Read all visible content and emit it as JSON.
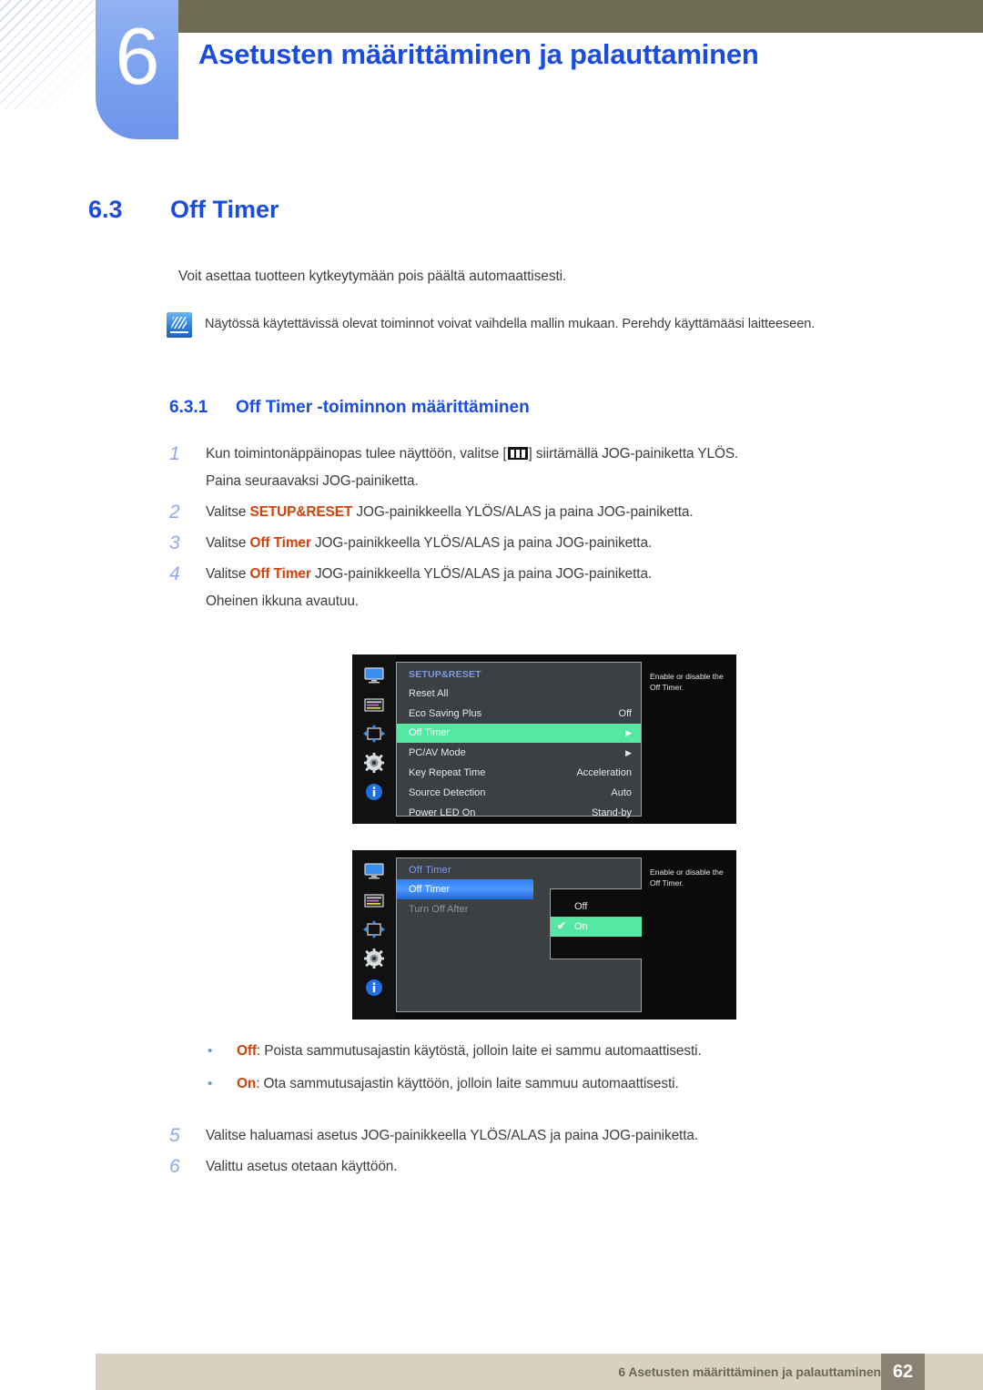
{
  "header": {
    "chapter_number": "6",
    "chapter_title": "Asetusten määrittäminen ja palauttaminen"
  },
  "section": {
    "number": "6.3",
    "title": "Off Timer",
    "intro": "Voit asettaa tuotteen kytkeytymään pois päältä automaattisesti.",
    "note": "Näytössä käytettävissä olevat toiminnot voivat vaihdella mallin mukaan. Perehdy käyttämääsi laitteeseen.",
    "note_icon": "note-pencil-icon"
  },
  "subsection": {
    "number": "6.3.1",
    "title": "Off Timer -toiminnon määrittäminen"
  },
  "steps": [
    {
      "num": "1",
      "pre": "Kun toimintonäppäinopas tulee näyttöön, valitse [",
      "icon": "jog-menu-icon",
      "post": "] siirtämällä JOG-painiketta YLÖS.",
      "sub": "Paina seuraavaksi JOG-painiketta."
    },
    {
      "num": "2",
      "pre": "Valitse ",
      "keyword": "SETUP&RESET",
      "post": " JOG-painikkeella YLÖS/ALAS ja paina JOG-painiketta.",
      "sub": ""
    },
    {
      "num": "3",
      "pre": "Valitse ",
      "keyword": "Off Timer",
      "post": " JOG-painikkeella YLÖS/ALAS ja paina JOG-painiketta.",
      "sub": ""
    },
    {
      "num": "4",
      "pre": "Valitse ",
      "keyword": "Off Timer",
      "post": " JOG-painikkeella YLÖS/ALAS ja paina JOG-painiketta.",
      "sub": "Oheinen ikkuna avautuu."
    }
  ],
  "osd_menu_1": {
    "title": "SETUP&RESET",
    "help_text": "Enable or disable the Off Timer.",
    "rail_icons": [
      "monitor-icon",
      "picture-sliders-icon",
      "move-arrows-icon",
      "gear-icon",
      "info-icon"
    ],
    "rows": [
      {
        "label": "Reset All",
        "value": "",
        "arrow": "",
        "state": "normal"
      },
      {
        "label": "Eco Saving Plus",
        "value": "Off",
        "arrow": "",
        "state": "normal"
      },
      {
        "label": "Off Timer",
        "value": "",
        "arrow": "▶",
        "state": "selected-green"
      },
      {
        "label": "PC/AV Mode",
        "value": "",
        "arrow": "▶",
        "state": "normal"
      },
      {
        "label": "Key Repeat Time",
        "value": "Acceleration",
        "arrow": "",
        "state": "normal"
      },
      {
        "label": "Source Detection",
        "value": "Auto",
        "arrow": "",
        "state": "normal"
      },
      {
        "label": "Power LED On",
        "value": "Stand-by",
        "arrow": "",
        "state": "normal"
      }
    ]
  },
  "osd_menu_2": {
    "title": "Off Timer",
    "help_text": "Enable or disable the Off Timer.",
    "rail_icons": [
      "monitor-icon",
      "picture-sliders-icon",
      "move-arrows-icon",
      "gear-icon",
      "info-icon"
    ],
    "rows": [
      {
        "label": "Off Timer",
        "state": "selected-blue"
      },
      {
        "label": "Turn Off After",
        "state": "dim"
      }
    ],
    "popup": {
      "options": [
        {
          "label": "Off",
          "selected": false,
          "check": ""
        },
        {
          "label": "On",
          "selected": true,
          "check": "✔"
        }
      ]
    }
  },
  "bullets": [
    {
      "marker": "•",
      "keyword": "Off",
      "text": ": Poista sammutusajastin käytöstä, jolloin laite ei sammu automaattisesti."
    },
    {
      "marker": "•",
      "keyword": "On",
      "text": ": Ota sammutusajastin käyttöön, jolloin laite sammuu automaattisesti."
    }
  ],
  "steps2": [
    {
      "num": "5",
      "pre": "Valitse haluamasi asetus JOG-painikkeella YLÖS/ALAS ja paina JOG-painiketta.",
      "keyword": "",
      "post": "",
      "sub": ""
    },
    {
      "num": "6",
      "pre": "Valittu asetus otetaan käyttöön.",
      "keyword": "",
      "post": "",
      "sub": ""
    }
  ],
  "footer": {
    "text": "6 Asetusten määrittäminen ja palauttaminen",
    "page_number": "62"
  },
  "colors": {
    "heading_blue": "#1b4ce0",
    "keyword_red": "#d2410a",
    "osd_green": "#55e8a2",
    "osd_blue": "#2f7ef4",
    "olive": "#6e6c55",
    "footer_beige": "#d7d2bf",
    "page_box": "#8a8173"
  }
}
